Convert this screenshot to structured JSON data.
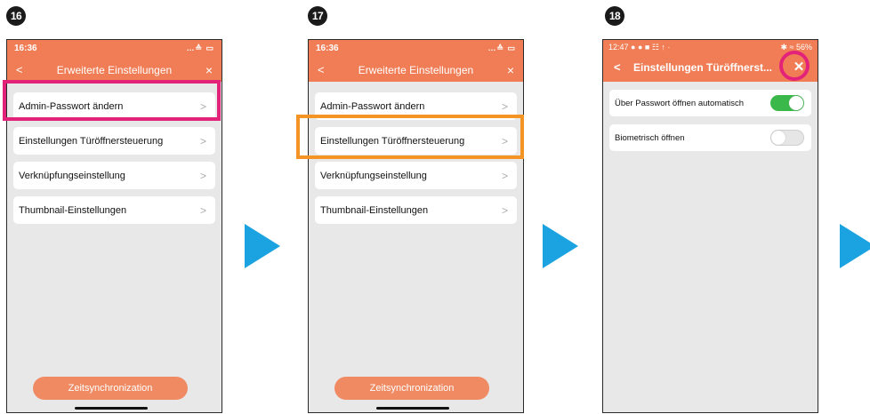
{
  "steps": [
    "16",
    "17",
    "18"
  ],
  "phone1": {
    "time": "16:36",
    "status_icons": "…≙ ▭",
    "back_glyph": "<",
    "title": "Erweiterte Einstellungen",
    "close_glyph": "×",
    "items": [
      "Admin-Passwort ändern",
      "Einstellungen Türöffnersteuerung",
      "Verknüpfungseinstellung",
      "Thumbnail-Einstellungen"
    ],
    "chevron": ">",
    "bottom_button": "Zeitsynchronization"
  },
  "phone2": {
    "time": "16:36",
    "status_icons": "…≙ ▭",
    "back_glyph": "<",
    "title": "Erweiterte Einstellungen",
    "close_glyph": "×",
    "items": [
      "Admin-Passwort ändern",
      "Einstellungen Türöffnersteuerung",
      "Verknüpfungseinstellung",
      "Thumbnail-Einstellungen"
    ],
    "chevron": ">",
    "bottom_button": "Zeitsynchronization"
  },
  "phone3": {
    "time": "12:47",
    "status_left_icons": "● ● ■ ☷ ↑ ·",
    "status_right_icons": "✱ ≈ 56%",
    "back_glyph": "<",
    "title": "Einstellungen Türöffnerst...",
    "close_glyph": "✕",
    "settings": [
      {
        "label": "Über Passwort öffnen automatisch",
        "on": true
      },
      {
        "label": "Biometrisch öffnen",
        "on": false
      }
    ]
  },
  "colors": {
    "accent_orange": "#f07d55",
    "arrow_blue": "#1aa3e0",
    "highlight_pink": "#e3237a",
    "highlight_orange": "#f39424",
    "toggle_green": "#3bb84a"
  }
}
